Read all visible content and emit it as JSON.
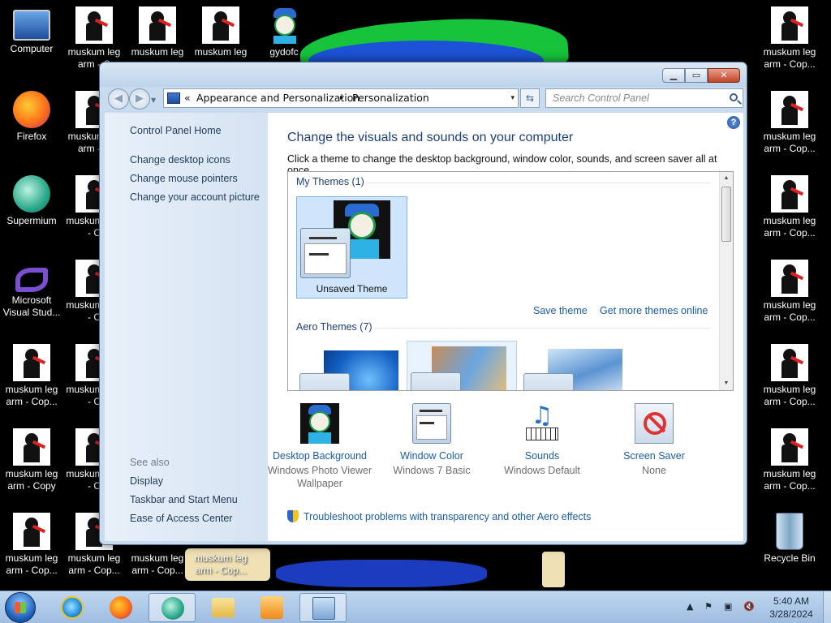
{
  "desktop": {
    "left_icons": [
      {
        "label": "Computer",
        "kind": "computer"
      },
      {
        "label": "Firefox",
        "kind": "firefox"
      },
      {
        "label": "Supermium",
        "kind": "supermium"
      },
      {
        "label": "Microsoft Visual Stud...",
        "kind": "vs"
      },
      {
        "label": "muskum leg arm - Cop...",
        "kind": "musk"
      },
      {
        "label": "muskum leg arm - Copy",
        "kind": "musk"
      },
      {
        "label": "muskum leg arm - Cop...",
        "kind": "musk"
      }
    ],
    "top_icons": [
      {
        "label": "muskum leg arm - C"
      },
      {
        "label": "muskum leg"
      },
      {
        "label": "muskum leg"
      },
      {
        "label": "gydofc"
      }
    ],
    "col2_icons": [
      {
        "label": "muskum leg arm - C"
      },
      {
        "label": "muskum arm - C"
      },
      {
        "label": "muskum arm - C"
      },
      {
        "label": "muskum arm - C"
      },
      {
        "label": "muskum arm - C"
      },
      {
        "label": "muskum leg arm - Cop..."
      }
    ],
    "bottom_icons": [
      {
        "label": "muskum leg arm - Cop..."
      },
      {
        "label": "muskum leg arm - Cop..."
      }
    ],
    "right_icons": [
      {
        "label": "muskum leg arm - Cop..."
      },
      {
        "label": "muskum leg arm - Cop..."
      },
      {
        "label": "muskum leg arm - Cop..."
      },
      {
        "label": "muskum leg arm - Cop..."
      },
      {
        "label": "muskum leg arm - Cop..."
      },
      {
        "label": "muskum leg arm - Cop..."
      },
      {
        "label": "Recycle Bin"
      }
    ]
  },
  "window": {
    "caption": {
      "minimize": "▁",
      "maximize": "▭",
      "close": "✕"
    },
    "address": {
      "chevron": "«",
      "crumb1": "Appearance and Personalization",
      "separator": "▸",
      "crumb2": "Personalization",
      "dropdown": "▾"
    },
    "refresh_glyph": "⇆",
    "search_placeholder": "Search Control Panel",
    "left_pane": {
      "home": "Control Panel Home",
      "links": [
        "Change desktop icons",
        "Change mouse pointers",
        "Change your account picture"
      ],
      "see_also_title": "See also",
      "see_also": [
        "Display",
        "Taskbar and Start Menu",
        "Ease of Access Center"
      ]
    },
    "content": {
      "heading": "Change the visuals and sounds on your computer",
      "subtext": "Click a theme to change the desktop background, window color, sounds, and screen saver all at once.",
      "help": "?",
      "my_themes_header": "My Themes (1)",
      "unsaved_theme": "Unsaved Theme",
      "save_theme": "Save theme",
      "get_more": "Get more themes online",
      "aero_header": "Aero Themes (7)",
      "bottom": [
        {
          "title": "Desktop Background",
          "sub": "Windows Photo Viewer Wallpaper"
        },
        {
          "title": "Window Color",
          "sub": "Windows 7 Basic"
        },
        {
          "title": "Sounds",
          "sub": "Windows Default"
        },
        {
          "title": "Screen Saver",
          "sub": "None"
        }
      ],
      "troubleshoot": "Troubleshoot problems with transparency and other Aero effects"
    }
  },
  "taskbar": {
    "clock_time": "5:40 AM",
    "clock_date": "3/28/2024",
    "tray_glyphs": [
      "▲",
      "⚑",
      "▣",
      "🔇"
    ]
  }
}
